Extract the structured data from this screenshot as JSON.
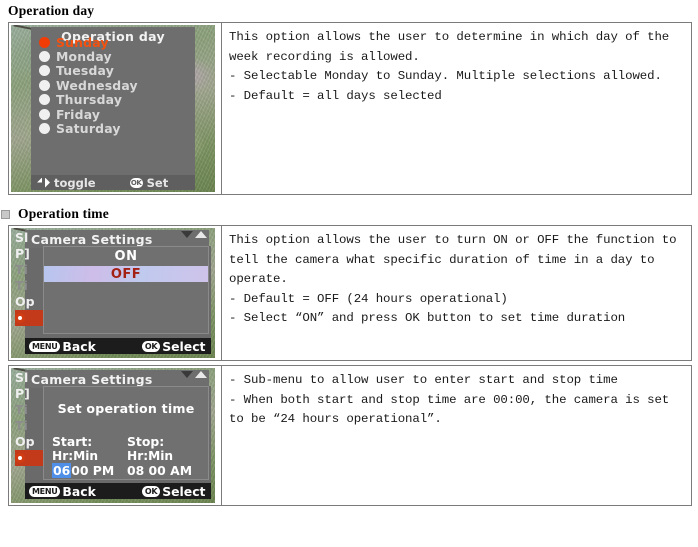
{
  "sections": [
    {
      "heading": "Operation day",
      "has_marker": false,
      "screenshot": {
        "title": "Operation day",
        "days": [
          {
            "label": "Sunday",
            "selected": true
          },
          {
            "label": "Monday",
            "selected": false
          },
          {
            "label": "Tuesday",
            "selected": false
          },
          {
            "label": "Wednesday",
            "selected": false
          },
          {
            "label": "Thursday",
            "selected": false
          },
          {
            "label": "Friday",
            "selected": false
          },
          {
            "label": "Saturday",
            "selected": false
          }
        ],
        "hint_left": "toggle",
        "hint_right": "Set"
      },
      "description": {
        "paragraph1": "This option allows the user to determine in which day of the",
        "paragraph1b": "week recording is allowed.",
        "bullets": [
          "-  Selectable Monday to Sunday. Multiple selections allowed.",
          "-  Default = all days selected"
        ]
      }
    },
    {
      "heading": "Operation time",
      "has_marker": true,
      "screenshot": {
        "title": "Camera Settings",
        "menu_items": [
          {
            "label": "Sl",
            "state": "normal"
          },
          {
            "label": "P]",
            "state": "normal"
          },
          {
            "label": "Ti",
            "state": "dim"
          },
          {
            "label": "Ti",
            "state": "dim"
          },
          {
            "label": "Op",
            "state": "normal"
          },
          {
            "label": "O",
            "state": "current"
          }
        ],
        "dialog": {
          "option_on": "ON",
          "option_off": "OFF",
          "selected": "OFF"
        },
        "menu_back_key": "MENU",
        "menu_back_label": "Back",
        "menu_select_key": "OK",
        "menu_select_label": "Select"
      },
      "description": {
        "paragraph1": "This option allows the user to turn ON or OFF the function to",
        "paragraph1b": "tell the camera what specific duration of time in a day to",
        "paragraph1c": "operate.",
        "bullets": [
          "-  Default = OFF (24 hours operational)",
          "-  Select “ON” and press OK button to set time duration"
        ]
      }
    },
    {
      "heading": "",
      "has_marker": false,
      "screenshot": {
        "title": "Camera Settings",
        "menu_items": [
          {
            "label": "Sl",
            "state": "normal"
          },
          {
            "label": "P]",
            "state": "normal"
          },
          {
            "label": "Ti",
            "state": "dim"
          },
          {
            "label": "Ti",
            "state": "dim"
          },
          {
            "label": "Op",
            "state": "normal"
          },
          {
            "label": "O",
            "state": "current"
          }
        ],
        "dialog": {
          "title": "Set operation time",
          "start_label": "Start:",
          "start_format": "Hr:Min",
          "start_hour": "06",
          "start_rest": "00 PM",
          "stop_label": "Stop:",
          "stop_format": "Hr:Min",
          "stop_value": "08 00 AM"
        },
        "menu_back_key": "MENU",
        "menu_back_label": "Back",
        "menu_select_key": "OK",
        "menu_select_label": "Select"
      },
      "description": {
        "bullets": [
          "-  Sub-menu to allow user to enter start and stop time",
          "-  When both start and stop time are 00:00, the camera is set"
        ],
        "continuation": "to be “24 hours operational”."
      }
    }
  ]
}
